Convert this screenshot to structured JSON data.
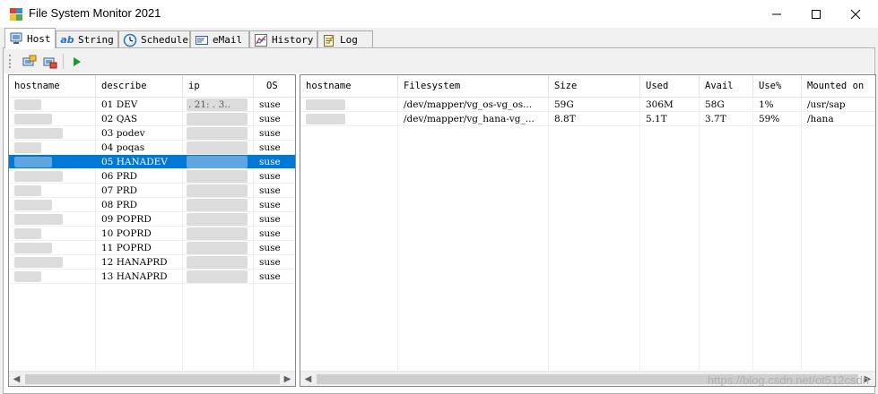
{
  "window": {
    "title": "File System Monitor 2021"
  },
  "tabs": [
    {
      "label": "Host",
      "icon": "host-icon",
      "active": true
    },
    {
      "label": "String",
      "icon": "ab-text-icon",
      "active": false
    },
    {
      "label": "Schedule",
      "icon": "clock-icon",
      "active": false
    },
    {
      "label": "eMail",
      "icon": "email-icon",
      "active": false
    },
    {
      "label": "History",
      "icon": "chart-icon",
      "active": false
    },
    {
      "label": "Log",
      "icon": "notepad-icon",
      "active": false
    }
  ],
  "toolbar": {
    "buttons": [
      "add-host-icon",
      "remove-host-icon",
      "run-icon"
    ]
  },
  "host_list": {
    "columns": [
      "hostname",
      "describe",
      "ip",
      "OS"
    ],
    "rows": [
      {
        "describe": "01 DEV",
        "ip": ". 21: . 3..",
        "os": "suse",
        "selected": false
      },
      {
        "describe": "02 QAS",
        "ip": "",
        "os": "suse",
        "selected": false
      },
      {
        "describe": "03 podev",
        "ip": "",
        "os": "suse",
        "selected": false
      },
      {
        "describe": "04 poqas",
        "ip": "",
        "os": "suse",
        "selected": false
      },
      {
        "describe": "05 HANADEV",
        "ip": "",
        "os": "suse",
        "selected": true
      },
      {
        "describe": "06 PRD",
        "ip": "",
        "os": "suse",
        "selected": false
      },
      {
        "describe": "07 PRD",
        "ip": "",
        "os": "suse",
        "selected": false
      },
      {
        "describe": "08 PRD",
        "ip": "",
        "os": "suse",
        "selected": false
      },
      {
        "describe": "09 POPRD",
        "ip": "",
        "os": "suse",
        "selected": false
      },
      {
        "describe": "10 POPRD",
        "ip": "",
        "os": "suse",
        "selected": false
      },
      {
        "describe": "11 POPRD",
        "ip": "",
        "os": "suse",
        "selected": false
      },
      {
        "describe": "12 HANAPRD",
        "ip": "",
        "os": "suse",
        "selected": false
      },
      {
        "describe": "13 HANAPRD",
        "ip": "",
        "os": "suse",
        "selected": false
      }
    ]
  },
  "fs_list": {
    "columns": [
      "hostname",
      "Filesystem",
      "Size",
      "Used",
      "Avail",
      "Use%",
      "Mounted on"
    ],
    "rows": [
      {
        "filesystem": "/dev/mapper/vg_os-vg_os...",
        "size": "59G",
        "used": "306M",
        "avail": "58G",
        "usepct": "1%",
        "mounted": "/usr/sap"
      },
      {
        "filesystem": "/dev/mapper/vg_hana-vg_...",
        "size": "8.8T",
        "used": "5.1T",
        "avail": "3.7T",
        "usepct": "59%",
        "mounted": "/hana"
      }
    ]
  },
  "watermark": "https://blog.csdn.net/ot512csdn",
  "colors": {
    "selection": "#0078d7",
    "run": "#1a9a2a"
  }
}
